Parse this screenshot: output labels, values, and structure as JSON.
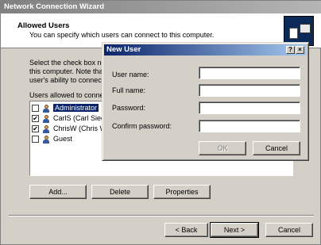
{
  "wizard": {
    "title": "Network Connection Wizard",
    "header_title": "Allowed Users",
    "header_subtitle": "You can specify which users can connect to this computer.",
    "intro_lines": [
      "Select the check box ne",
      "this computer.  Note tha",
      "user's ability to connect."
    ],
    "users_label": "Users allowed to connec",
    "users": [
      {
        "label": "Administrator",
        "checked": false,
        "selected": true
      },
      {
        "label": "CarlS (Carl Siech",
        "checked": true,
        "selected": false
      },
      {
        "label": "ChrisW (Chris W",
        "checked": true,
        "selected": false
      },
      {
        "label": "Guest",
        "checked": false,
        "selected": false
      }
    ],
    "buttons": {
      "add": "Add...",
      "delete": "Delete",
      "properties": "Properties",
      "back": "< Back",
      "next": "Next >",
      "cancel": "Cancel"
    },
    "icon": "network-wizard-icon"
  },
  "dialog": {
    "title": "New User",
    "help_label": "?",
    "close_label": "×",
    "fields": [
      {
        "label": "User name:",
        "value": ""
      },
      {
        "label": "Full name:",
        "value": ""
      },
      {
        "label": "Password:",
        "value": ""
      },
      {
        "label": "Confirm password:",
        "value": ""
      }
    ],
    "ok_label": "OK",
    "cancel_label": "Cancel"
  },
  "colors": {
    "face": "#d4d0c8",
    "active_title": "#0a246a",
    "inactive_title": "#808080",
    "selection": "#0a246a"
  }
}
